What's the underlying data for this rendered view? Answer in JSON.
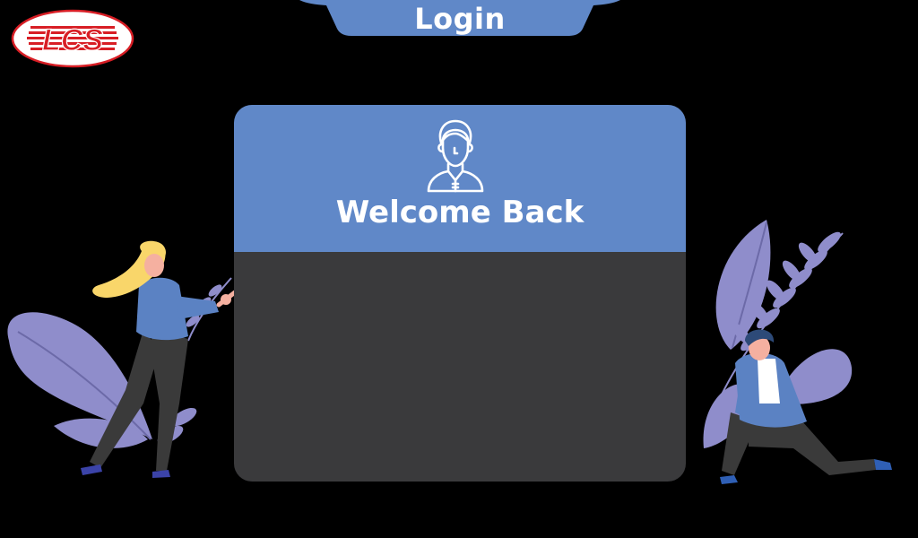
{
  "app": {
    "logo_text": "LCS",
    "title": "Login"
  },
  "card": {
    "heading": "Welcome Back",
    "header_icon": "user-avatar-icon"
  },
  "colors": {
    "accent": "#6088c8",
    "card_body": "#3a3a3c",
    "background": "#000000",
    "logo_red": "#d81e25",
    "plant": "#8f8dcb"
  }
}
